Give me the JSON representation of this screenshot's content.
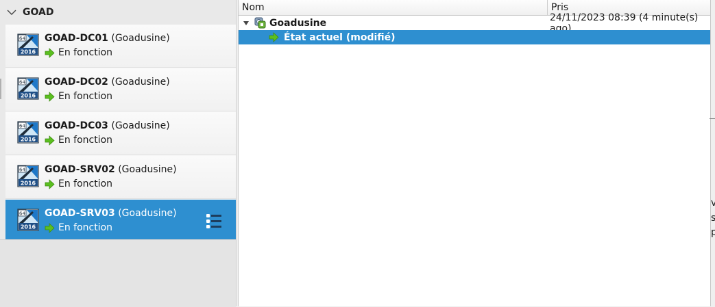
{
  "group": {
    "title": "GOAD",
    "expanded": true
  },
  "vms": [
    {
      "name": "GOAD-DC01",
      "group": "(Goadusine)",
      "state": "En fonction",
      "badge_top": "64",
      "badge_bottom": "2016",
      "selected": false
    },
    {
      "name": "GOAD-DC02",
      "group": "(Goadusine)",
      "state": "En fonction",
      "badge_top": "64",
      "badge_bottom": "2016",
      "selected": false
    },
    {
      "name": "GOAD-DC03",
      "group": "(Goadusine)",
      "state": "En fonction",
      "badge_top": "64",
      "badge_bottom": "2016",
      "selected": false
    },
    {
      "name": "GOAD-SRV02",
      "group": "(Goadusine)",
      "state": "En fonction",
      "badge_top": "64",
      "badge_bottom": "2016",
      "selected": false
    },
    {
      "name": "GOAD-SRV03",
      "group": "(Goadusine)",
      "state": "En fonction",
      "badge_top": "64",
      "badge_bottom": "2016",
      "selected": true
    }
  ],
  "snapshots": {
    "columns": {
      "name": "Nom",
      "taken": "Pris"
    },
    "root": {
      "name": "Goadusine",
      "taken": "24/11/2023 08:39 (4 minute(s) ago)"
    },
    "current": {
      "name": "État actuel (modifié)"
    }
  },
  "edge_fragments": [
    "v",
    "s",
    "p"
  ],
  "colors": {
    "selection": "#2e8fd0",
    "running_arrow": "#5bbf1f"
  }
}
